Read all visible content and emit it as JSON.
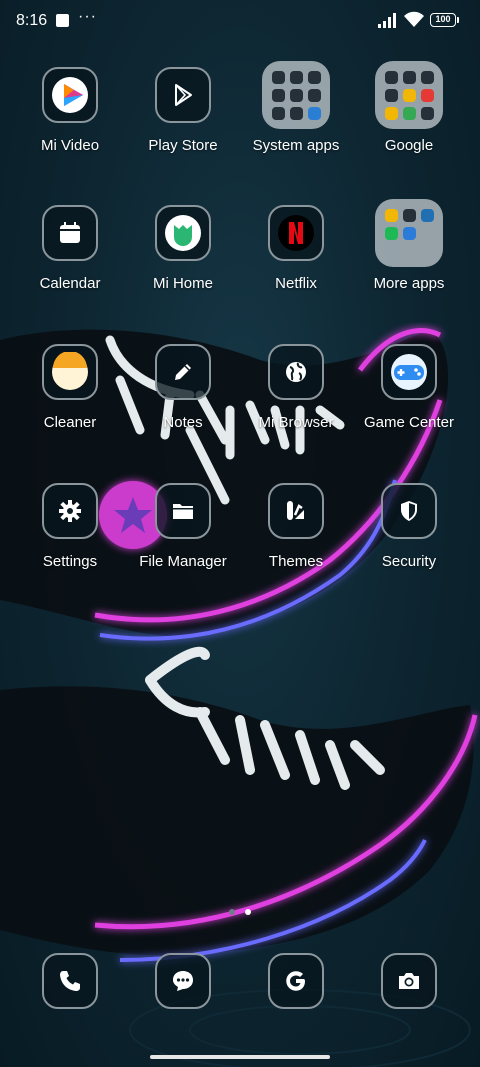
{
  "status_bar": {
    "time": "8:16",
    "dots": "···",
    "battery": "100"
  },
  "apps": [
    {
      "label": "Mi Video",
      "icon": "mi-video-icon"
    },
    {
      "label": "Play Store",
      "icon": "play-store-icon"
    },
    {
      "label": "System apps",
      "icon": "folder-icon"
    },
    {
      "label": "Google",
      "icon": "folder-icon"
    },
    {
      "label": "Calendar",
      "icon": "calendar-icon"
    },
    {
      "label": "Mi Home",
      "icon": "mi-home-icon"
    },
    {
      "label": "Netflix",
      "icon": "netflix-icon"
    },
    {
      "label": "More apps",
      "icon": "folder-icon"
    },
    {
      "label": "Cleaner",
      "icon": "cleaner-icon"
    },
    {
      "label": "Notes",
      "icon": "pencil-icon"
    },
    {
      "label": "Mi Browser",
      "icon": "globe-icon"
    },
    {
      "label": "Game Center",
      "icon": "gamepad-icon"
    },
    {
      "label": "Settings",
      "icon": "gear-icon"
    },
    {
      "label": "File Manager",
      "icon": "folder-icon"
    },
    {
      "label": "Themes",
      "icon": "themes-icon"
    },
    {
      "label": "Security",
      "icon": "shield-icon"
    }
  ],
  "dock": [
    {
      "icon": "phone-icon"
    },
    {
      "icon": "messages-icon"
    },
    {
      "icon": "google-icon"
    },
    {
      "icon": "camera-icon"
    }
  ],
  "pages": {
    "count": 2,
    "current": 2
  },
  "colors": {
    "neon_pink": "#e040e0",
    "neon_blue": "#6a6cff",
    "background": "#0e2733"
  }
}
